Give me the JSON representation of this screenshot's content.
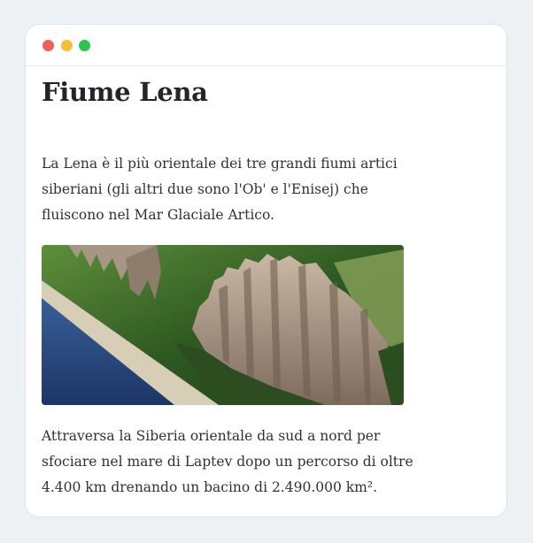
{
  "window": {
    "controls": {
      "close_color": "#f0605b",
      "minimize_color": "#f7bd33",
      "zoom_color": "#2ec54c"
    }
  },
  "article": {
    "title": "Fiume Lena",
    "intro": "La Lena è il più orientale dei tre grandi fiumi artici siberiani (gli altri due sono l'Ob' e l'Enisej) che fluiscono nel Mar Glaciale Artico.",
    "outro": "Attraversa la Siberia orientale da sud a nord per sfociare nel mare di Laptev dopo un percorso di oltre 4.400 km drenando un bacino di 2.490.000 km².",
    "image_alt": "Lena Pillars"
  }
}
